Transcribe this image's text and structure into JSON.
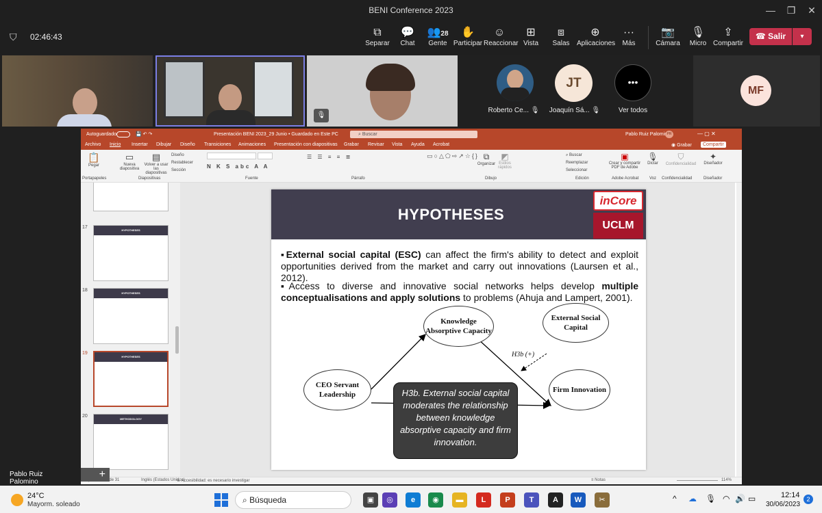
{
  "window": {
    "title": "BENI Conference 2023"
  },
  "meeting": {
    "time": "02:46:43",
    "people_count": "28"
  },
  "toolbar": {
    "items": [
      "Separar",
      "Chat",
      "Gente",
      "Participar",
      "Reaccionar",
      "Vista",
      "Salas",
      "Aplicaciones",
      "Más",
      "Cámara",
      "Micro",
      "Compartir"
    ],
    "leave": "Salir"
  },
  "participants": [
    {
      "name": "Roberto Ce..."
    },
    {
      "name": "Joaquín Sá...",
      "initials": "JT"
    },
    {
      "label": "Ver todos"
    },
    {
      "initials": "MF"
    }
  ],
  "presenter_name": "Pablo Ruiz Palomino",
  "ppt": {
    "autosave": "Autoguardado",
    "filename": "Presentación BENI 2023_29 Junio • Guardado en Este PC",
    "search": "Buscar",
    "user": "Pablo Ruiz Palomino",
    "user_initials": "PR",
    "menu": [
      "Archivo",
      "Inicio",
      "Insertar",
      "Dibujar",
      "Diseño",
      "Transiciones",
      "Animaciones",
      "Presentación con diapositivas",
      "Grabar",
      "Revisar",
      "Vista",
      "Ayuda",
      "Acrobat"
    ],
    "grabar": "Grabar",
    "compartir": "Compartir",
    "groups": [
      "Portapapeles",
      "Diapositivas",
      "Fuente",
      "Párrafo",
      "Dibujo",
      "Edición",
      "Adobe Acrobat",
      "Voz",
      "Confidencialidad",
      "Diseñador"
    ],
    "ribbon_btns": [
      "Pegar",
      "Nueva diapositiva",
      "Volver a usar las diapositivas",
      "Diseño",
      "Restablecer",
      "Sección",
      "Organizar",
      "Estilos rápidos",
      "Buscar",
      "Reemplazar",
      "Seleccionar",
      "Crear y compartir PDF de Adobe",
      "Dictar",
      "Confidencialidad",
      "Diseñador"
    ],
    "thumb_nums": [
      "17",
      "18",
      "19",
      "20"
    ],
    "thumb_titles": [
      "HYPOTHESES",
      "HYPOTHESES",
      "HYPOTHESES",
      "METHODOLOGY"
    ],
    "status": {
      "slide": "Diapositiva 19 de 31",
      "lang": "Inglés (Estados Unidos)",
      "access": "Accesibilidad: es necesario investigar",
      "notes": "Notas",
      "zoom": "114%"
    }
  },
  "slide": {
    "title": "HYPOTHESES",
    "logo1": "inCore",
    "logo2": "UCLM",
    "bullet1_bold": "External social capital (ESC)",
    "bullet1_rest": " can affect the firm's ability to detect and exploit opportunities derived from the market and carry out innovations (Laursen et al., 2012).",
    "bullet2_a": "Access to diverse and innovative social networks helps develop ",
    "bullet2_bold": "multiple conceptualisations and apply solutions",
    "bullet2_c": " to problems (Ahuja and Lampert, 2001).",
    "nodes": {
      "kac": "Knowledge Absorptive Capacity",
      "esc": "External Social Capital",
      "ceo": "CEO Servant Leadership",
      "fi": "Firm Innovation"
    },
    "arrow_label": "H3b (+)",
    "callout": "H3b. External social capital moderates the relationship between knowledge absorptive capacity and firm innovation."
  },
  "taskbar": {
    "temp": "24°C",
    "weather": "Mayorm. soleado",
    "search": "Búsqueda",
    "time": "12:14",
    "date": "30/06/2023",
    "badge": "2"
  }
}
